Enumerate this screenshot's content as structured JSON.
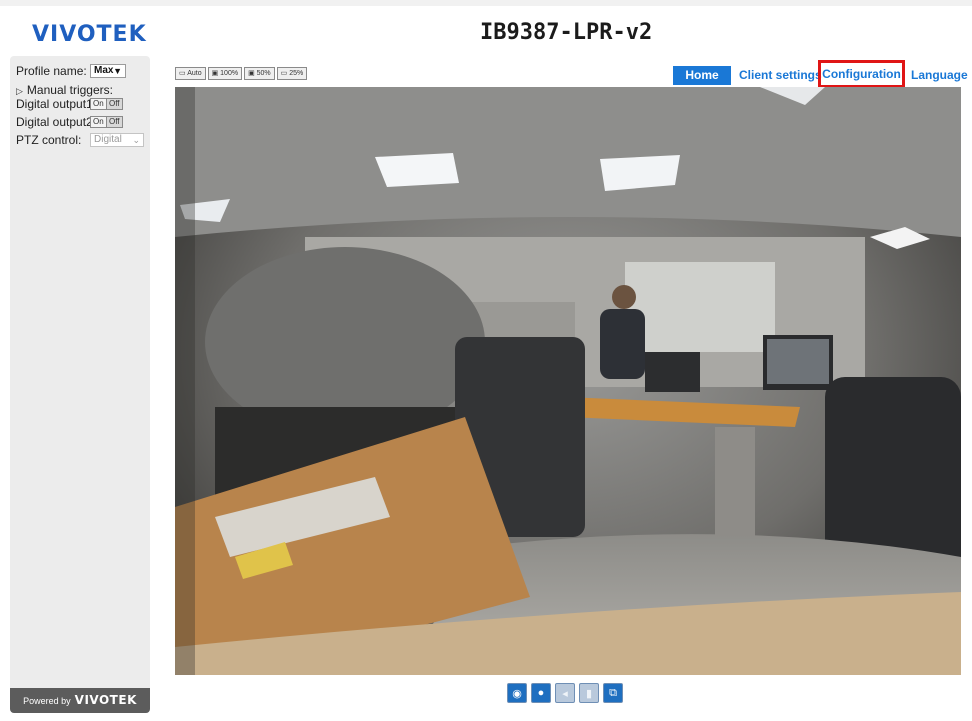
{
  "header": {
    "brand": "VIVOTEK",
    "camera_title": "IB9387-LPR-v2"
  },
  "sidebar": {
    "profile_label": "Profile name:",
    "profile_value": "Max",
    "manual_triggers_label": "Manual triggers:",
    "digital_output1_label": "Digital output1:",
    "digital_output2_label": "Digital output2:",
    "on_label": "On",
    "off_label": "Off",
    "ptz_label": "PTZ control:",
    "ptz_value": "Digital",
    "powered_by": "Powered by",
    "powered_brand": "VIVOTEK"
  },
  "zoom": {
    "auto": "Auto",
    "z100": "100%",
    "z50": "50%",
    "z25": "25%"
  },
  "nav": {
    "home": "Home",
    "client_settings": "Client settings",
    "configuration": "Configuration",
    "language": "Language"
  },
  "controls": [
    {
      "icon": "camera-icon",
      "state": "active"
    },
    {
      "icon": "stop-icon",
      "state": "active"
    },
    {
      "icon": "speaker-icon",
      "state": "disabled"
    },
    {
      "icon": "mic-icon",
      "state": "disabled"
    },
    {
      "icon": "fullscreen-icon",
      "state": "active"
    }
  ],
  "colors": {
    "brand_blue": "#1f5fbf",
    "link_blue": "#1a78d6",
    "highlight_red": "#e01515"
  }
}
